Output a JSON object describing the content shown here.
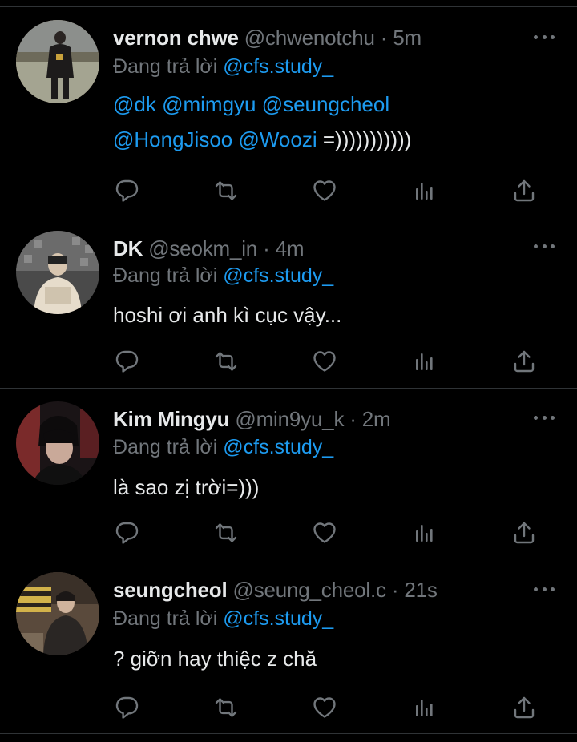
{
  "tweets": [
    {
      "name": "vernon chwe",
      "handle": "@chwenotchu",
      "dot": "·",
      "time": "5m",
      "replying_prefix": "Đang trả lời ",
      "replying_to": "@cfs.study_",
      "body_line1": "@dk @mimgyu @seungcheol",
      "body_line2_mentions": "@HongJisoo @Woozi",
      "body_line2_text": " =)))))))))))"
    },
    {
      "name": "DK",
      "handle": "@seokm_in",
      "dot": "·",
      "time": "4m",
      "replying_prefix": "Đang trả lời ",
      "replying_to": "@cfs.study_",
      "body": "hoshi ơi anh kì cục vậy..."
    },
    {
      "name": "Kim Mingyu",
      "handle": "@min9yu_k",
      "dot": "·",
      "time": "2m",
      "replying_prefix": "Đang trả lời ",
      "replying_to": "@cfs.study_",
      "body": "là sao zị trời=)))"
    },
    {
      "name": "seungcheol",
      "handle": "@seung_cheol.c",
      "dot": "·",
      "time": "21s",
      "replying_prefix": "Đang trả lời ",
      "replying_to": "@cfs.study_",
      "body": "? giỡn hay thiệc z chă"
    }
  ],
  "icons": {
    "reply": "reply-icon",
    "retweet": "retweet-icon",
    "like": "heart-icon",
    "views": "views-icon",
    "share": "share-icon",
    "more": "more-icon"
  },
  "colors": {
    "background": "#000000",
    "text": "#e7e9ea",
    "secondary": "#71767b",
    "link": "#1d9bf0",
    "divider": "#2f3336"
  }
}
